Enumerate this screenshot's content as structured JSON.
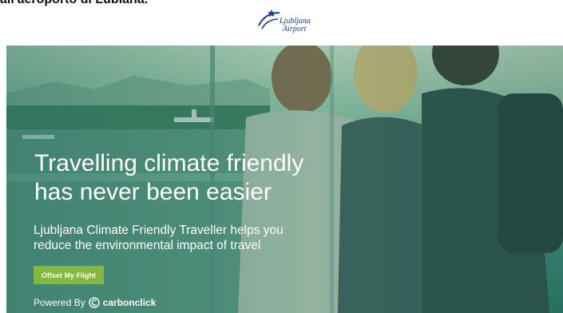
{
  "page": {
    "top_caption": "all'aeroporto di Lubiana.",
    "logo": {
      "line1": "Ljubljana",
      "line2": "Airport",
      "color": "#1f3f8f"
    }
  },
  "hero": {
    "headline_line1": "Travelling climate friendly",
    "headline_line2": "has never been easier",
    "subtext_line1": "Ljubljana Climate Friendly Traveller helps you",
    "subtext_line2": "reduce the environmental impact of travel",
    "cta_label": "Offset My Flight",
    "cta_color": "#83b93e",
    "powered_by": "Powered By",
    "brand": "carbonclick",
    "brand_icon": "carbonclick-logo-icon"
  }
}
